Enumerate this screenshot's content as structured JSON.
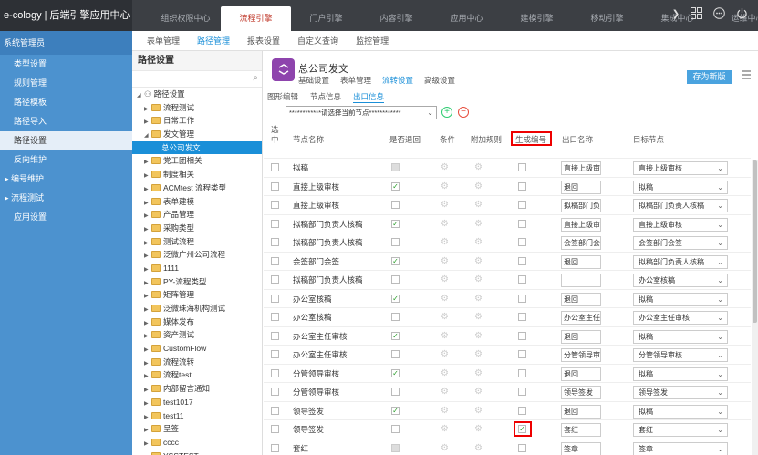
{
  "app": {
    "brand": "e-cology | 后端引擎应用中心"
  },
  "topnav": [
    "组织权限中心",
    "流程引擎",
    "门户引擎",
    "内容引擎",
    "应用中心",
    "建模引擎",
    "移动引擎",
    "集成中心",
    "运维中心"
  ],
  "topnav_active": 1,
  "top_icons": [
    "chevron-right-icon",
    "grid-icon",
    "more-icon",
    "power-icon"
  ],
  "sidebar": {
    "header": "系统管理员",
    "items": [
      {
        "label": "类型设置",
        "group": false
      },
      {
        "label": "规则管理",
        "group": false
      },
      {
        "label": "路径模板",
        "group": false
      },
      {
        "label": "路径导入",
        "group": false
      },
      {
        "label": "路径设置",
        "group": false,
        "active": true
      },
      {
        "label": "反向维护",
        "group": false
      },
      {
        "label": "▸ 编号维护",
        "group": true
      },
      {
        "label": "▸ 流程测试",
        "group": true
      },
      {
        "label": "应用设置",
        "group": false
      }
    ]
  },
  "subnav": [
    "表单管理",
    "路径管理",
    "报表设置",
    "自定义查询",
    "监控管理"
  ],
  "subnav_active": 1,
  "tree": {
    "title": "路径设置",
    "root": "路径设置",
    "items": [
      {
        "label": "流程测试",
        "level": 1,
        "sel": false
      },
      {
        "label": "日常工作",
        "level": 1,
        "sel": false
      },
      {
        "label": "发文管理",
        "level": 1,
        "sel": false,
        "open": true
      },
      {
        "label": "总公司发文",
        "level": 2,
        "sel": true
      },
      {
        "label": "党工团相关",
        "level": 1,
        "sel": false
      },
      {
        "label": "制度相关",
        "level": 1,
        "sel": false
      },
      {
        "label": "ACMtest 流程类型",
        "level": 1,
        "sel": false
      },
      {
        "label": "表单建模",
        "level": 1,
        "sel": false
      },
      {
        "label": "产品管理",
        "level": 1,
        "sel": false
      },
      {
        "label": "采购类型",
        "level": 1,
        "sel": false
      },
      {
        "label": "测试流程",
        "level": 1,
        "sel": false
      },
      {
        "label": "泛微广州公司流程",
        "level": 1,
        "sel": false
      },
      {
        "label": "1111",
        "level": 1,
        "sel": false
      },
      {
        "label": "PY-流程类型",
        "level": 1,
        "sel": false
      },
      {
        "label": "矩阵管理",
        "level": 1,
        "sel": false
      },
      {
        "label": "泛微珠海机构测试",
        "level": 1,
        "sel": false
      },
      {
        "label": "媒体发布",
        "level": 1,
        "sel": false
      },
      {
        "label": "资产测试",
        "level": 1,
        "sel": false
      },
      {
        "label": "CustomFlow",
        "level": 1,
        "sel": false
      },
      {
        "label": "流程流转",
        "level": 1,
        "sel": false
      },
      {
        "label": "流程test",
        "level": 1,
        "sel": false
      },
      {
        "label": "内部留言通知",
        "level": 1,
        "sel": false
      },
      {
        "label": "test1017",
        "level": 1,
        "sel": false
      },
      {
        "label": "test11",
        "level": 1,
        "sel": false
      },
      {
        "label": "呈签",
        "level": 1,
        "sel": false
      },
      {
        "label": "cccc",
        "level": 1,
        "sel": false
      },
      {
        "label": "YSSTEST",
        "level": 1,
        "sel": false
      }
    ]
  },
  "header": {
    "title": "总公司发文",
    "tabs": [
      "基础设置",
      "表单管理",
      "流转设置",
      "高级设置"
    ],
    "tabs_active": 2,
    "save_label": "存为新版"
  },
  "subtabs": [
    "图形编辑",
    "节点信息",
    "出口信息"
  ],
  "subtabs_active": 2,
  "node_select": "************请选择当前节点************",
  "table": {
    "headers": {
      "sel": "选\n中",
      "node": "节点名称",
      "back": "是否退回",
      "cond": "条件",
      "rule": "附加规则",
      "gen": "生成编号",
      "exit": "出口名称",
      "target": "目标节点"
    },
    "rows": [
      {
        "node": "拟稿",
        "back": "dis",
        "gen": false,
        "exit": "直接上级审",
        "target": "直接上级审核"
      },
      {
        "node": "直接上级审核",
        "back": true,
        "gen": false,
        "exit": "退回",
        "target": "拟稿"
      },
      {
        "node": "直接上级审核",
        "back": false,
        "gen": false,
        "exit": "拟稿部门负",
        "target": "拟稿部门负责人核稿"
      },
      {
        "node": "拟稿部门负责人核稿",
        "back": true,
        "gen": false,
        "exit": "直接上级审",
        "target": "直接上级审核"
      },
      {
        "node": "拟稿部门负责人核稿",
        "back": false,
        "gen": false,
        "exit": "会签部门会",
        "target": "会签部门会签"
      },
      {
        "node": "会签部门会签",
        "back": true,
        "gen": false,
        "exit": "退回",
        "target": "拟稿部门负责人核稿"
      },
      {
        "node": "拟稿部门负责人核稿",
        "back": false,
        "gen": false,
        "exit": "",
        "target": "办公室核稿"
      },
      {
        "node": "办公室核稿",
        "back": true,
        "gen": false,
        "exit": "退回",
        "target": "拟稿"
      },
      {
        "node": "办公室核稿",
        "back": false,
        "gen": false,
        "exit": "办公室主任",
        "target": "办公室主任审核"
      },
      {
        "node": "办公室主任审核",
        "back": true,
        "gen": false,
        "exit": "退回",
        "target": "拟稿"
      },
      {
        "node": "办公室主任审核",
        "back": false,
        "gen": false,
        "exit": "分管领导审",
        "target": "分管领导审核"
      },
      {
        "node": "分管领导审核",
        "back": true,
        "gen": false,
        "exit": "退回",
        "target": "拟稿"
      },
      {
        "node": "分管领导审核",
        "back": false,
        "gen": false,
        "exit": "领导签发",
        "target": "领导签发"
      },
      {
        "node": "领导签发",
        "back": true,
        "gen": false,
        "exit": "退回",
        "target": "拟稿"
      },
      {
        "node": "领导签发",
        "back": false,
        "gen": true,
        "exit": "套红",
        "target": "套红"
      },
      {
        "node": "套红",
        "back": "dis",
        "gen": false,
        "exit": "签章",
        "target": "签章"
      }
    ]
  }
}
